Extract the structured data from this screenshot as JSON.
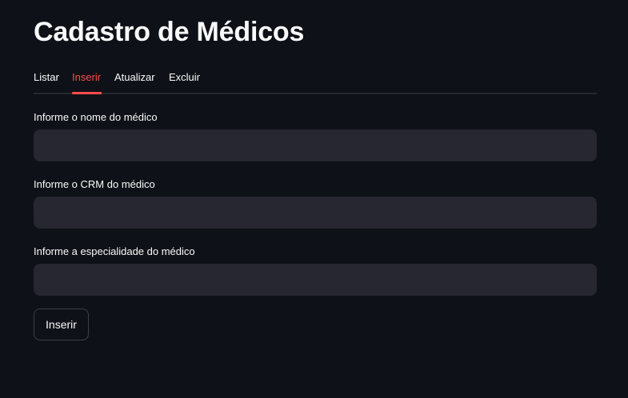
{
  "page": {
    "title": "Cadastro de Médicos"
  },
  "tabs": [
    {
      "label": "Listar",
      "active": false
    },
    {
      "label": "Inserir",
      "active": true
    },
    {
      "label": "Atualizar",
      "active": false
    },
    {
      "label": "Excluir",
      "active": false
    }
  ],
  "form": {
    "fields": [
      {
        "label": "Informe o nome do médico",
        "value": "",
        "placeholder": ""
      },
      {
        "label": "Informe o CRM do médico",
        "value": "",
        "placeholder": ""
      },
      {
        "label": "Informe a especialidade do médico",
        "value": "",
        "placeholder": ""
      }
    ],
    "submit_label": "Inserir"
  },
  "colors": {
    "background": "#0e1117",
    "accent": "#ff4b4b",
    "input_background": "#262730",
    "text": "#fafafa"
  }
}
